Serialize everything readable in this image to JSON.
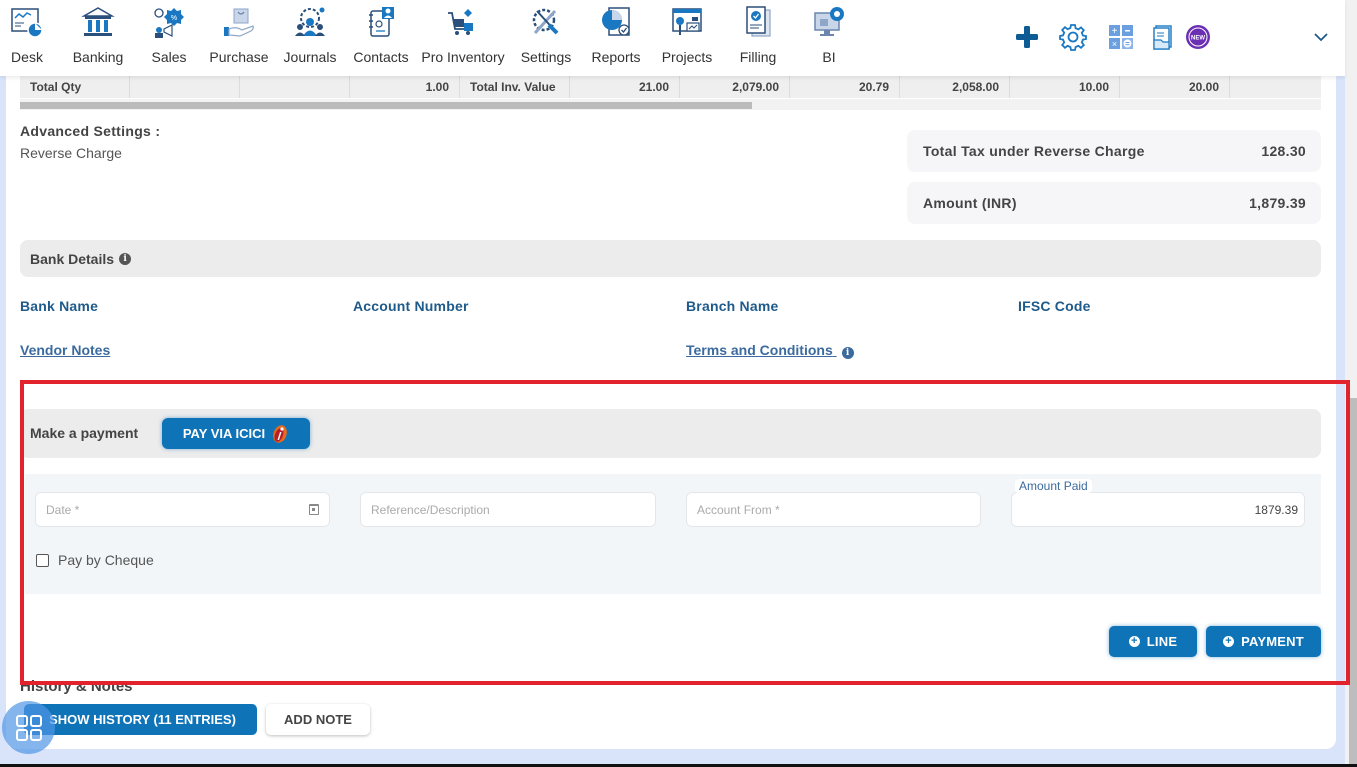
{
  "nav": {
    "items": [
      {
        "label": "Desk",
        "icon": "desk-icon"
      },
      {
        "label": "Banking",
        "icon": "bank-icon"
      },
      {
        "label": "Sales",
        "icon": "sales-icon"
      },
      {
        "label": "Purchase",
        "icon": "purchase-icon"
      },
      {
        "label": "Journals",
        "icon": "journals-icon"
      },
      {
        "label": "Contacts",
        "icon": "contacts-icon"
      },
      {
        "label": "Pro Inventory",
        "icon": "inventory-icon"
      },
      {
        "label": "Settings",
        "icon": "settings-tools-icon"
      },
      {
        "label": "Reports",
        "icon": "reports-icon"
      },
      {
        "label": "Projects",
        "icon": "projects-icon"
      },
      {
        "label": "Filling",
        "icon": "filing-icon"
      },
      {
        "label": "BI",
        "icon": "bi-icon"
      }
    ],
    "right_icons": [
      "plus-icon",
      "gear-icon",
      "calculator-icon",
      "document-icon",
      "new-badge-icon",
      "chevron-down-icon"
    ],
    "new_badge_text": "NEW"
  },
  "totals_row": {
    "cells": [
      "Total Qty",
      "",
      "",
      "1.00",
      "Total Inv. Value",
      "21.00",
      "2,079.00",
      "20.79",
      "2,058.00",
      "10.00",
      "20.00",
      ""
    ]
  },
  "advanced_settings": {
    "title": "Advanced Settings :",
    "value": "Reverse Charge"
  },
  "summary": {
    "tax_label": "Total Tax under Reverse Charge",
    "tax_value": "128.30",
    "amount_label": "Amount (INR)",
    "amount_value": "1,879.39"
  },
  "bank_details": {
    "title": "Bank Details",
    "labels": [
      "Bank Name",
      "Account Number",
      "Branch Name",
      "IFSC Code"
    ],
    "vendor_notes": "Vendor Notes",
    "terms": "Terms and Conditions"
  },
  "payment": {
    "title": "Make a payment",
    "icici_button": "PAY VIA ICICI",
    "date_placeholder": "Date *",
    "reference_placeholder": "Reference/Description",
    "account_placeholder": "Account From *",
    "amount_label": "Amount Paid",
    "amount_value": "1879.39",
    "cheque_label": "Pay by Cheque",
    "cheque_checked": false,
    "line_button": "LINE",
    "payment_button": "PAYMENT",
    "colors": {
      "primary": "#0f73b8",
      "highlight": "#e3232b"
    }
  },
  "history": {
    "title": "History & Notes",
    "show_button": "SHOW HISTORY (11 ENTRIES)",
    "add_note_button": "ADD NOTE"
  }
}
